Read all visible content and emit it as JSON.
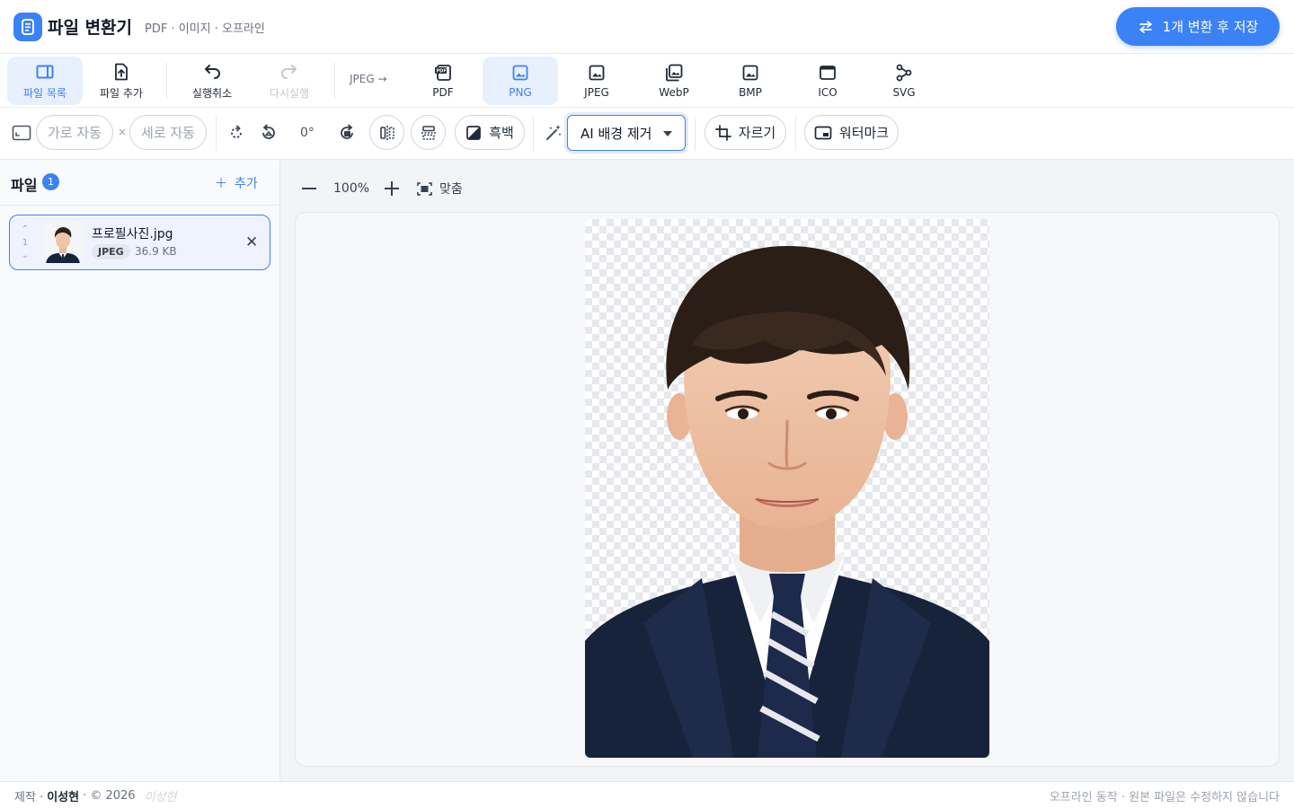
{
  "header": {
    "title": "파일 변환기",
    "subtitle": "PDF · 이미지 · 오프라인",
    "save_button": "1개 변환 후 저장"
  },
  "toolbar": {
    "file_list": "파일 목록",
    "add_file": "파일 추가",
    "undo": "실행취소",
    "redo": "다시실행",
    "source_format": "JPEG →",
    "formats": [
      "PDF",
      "PNG",
      "JPEG",
      "WebP",
      "BMP",
      "ICO",
      "SVG"
    ],
    "selected_format": "PNG"
  },
  "edit": {
    "width_placeholder": "가로 자동",
    "times": "×",
    "height_placeholder": "세로 자동",
    "rotation": "0°",
    "grayscale": "흑백",
    "bg_remove_selected": "AI 배경 제거",
    "crop": "자르기",
    "watermark": "워터마크"
  },
  "sidebar": {
    "title": "파일",
    "count": "1",
    "add": "추가",
    "files": [
      {
        "order": "1",
        "name": "프로필사진.jpg",
        "format": "JPEG",
        "size": "36.9 KB"
      }
    ]
  },
  "viewer": {
    "zoom": "100%",
    "fit": "맞춤"
  },
  "footer": {
    "made_by_label": "제작 ·",
    "author": "이성현",
    "copyright": "· © 2026",
    "note": "오프라인 동작 · 원본 파일은 수정하지 않습니다"
  },
  "colors": {
    "accent": "#3b82f6",
    "accent_soft": "#e8effd",
    "suit": "#17223b"
  }
}
